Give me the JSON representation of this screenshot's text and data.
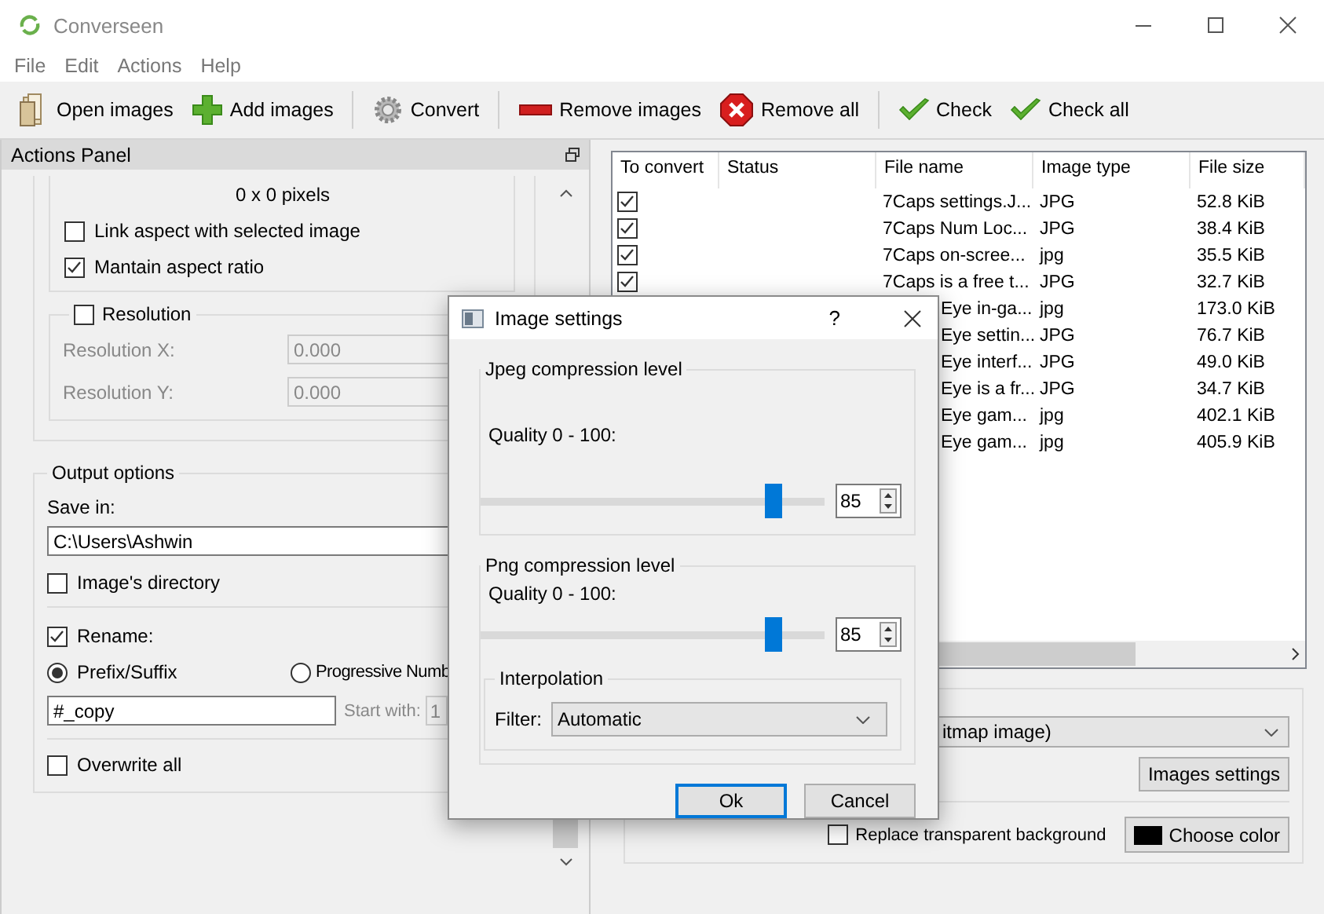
{
  "window": {
    "title": "Converseen"
  },
  "menu": [
    "File",
    "Edit",
    "Actions",
    "Help"
  ],
  "toolbar": [
    {
      "label": "Open images",
      "separator_before": false
    },
    {
      "label": "Add images",
      "separator_before": false
    },
    {
      "label": "Convert",
      "separator_before": true
    },
    {
      "label": "Remove images",
      "separator_before": true
    },
    {
      "label": "Remove all",
      "separator_before": false
    },
    {
      "label": "Check",
      "separator_before": true
    },
    {
      "label": "Check all",
      "separator_before": false
    }
  ],
  "actions_panel": {
    "title": "Actions Panel",
    "size_text": "0 x 0 pixels",
    "link_aspect": {
      "label": "Link aspect with selected image",
      "checked": false
    },
    "maintain_aspect": {
      "label": "Mantain aspect ratio",
      "checked": true
    },
    "resolution": {
      "label": "Resolution",
      "checked": false,
      "fields": [
        {
          "label": "Resolution X:",
          "value": "0.000",
          "disabled": true
        },
        {
          "label": "Resolution Y:",
          "value": "0.000",
          "disabled": true
        }
      ]
    },
    "output_options": {
      "title": "Output options",
      "save_in_label": "Save in:",
      "save_in": "C:\\Users\\Ashwin",
      "image_directory": {
        "label": "Image's directory",
        "checked": false
      },
      "rename": {
        "label": "Rename:",
        "checked": true
      },
      "rename_modes": [
        {
          "label": "Prefix/Suffix",
          "selected": true
        },
        {
          "label": "Progressive Numb",
          "selected": false
        }
      ],
      "pattern": "#_copy",
      "start_with": {
        "label": "Start with:",
        "value": "1",
        "disabled": true
      },
      "overwrite": {
        "label": "Overwrite all",
        "checked": false
      }
    }
  },
  "table": {
    "columns": [
      "To convert",
      "Status",
      "File name",
      "Image type",
      "File size"
    ],
    "rows": [
      {
        "kind": "full",
        "checked": true,
        "file_name": "7Caps settings.J...",
        "image_type": "JPG",
        "file_size": "52.8 KiB"
      },
      {
        "kind": "full",
        "checked": true,
        "file_name": "7Caps Num Loc...",
        "image_type": "JPG",
        "file_size": "38.4 KiB"
      },
      {
        "kind": "full",
        "checked": true,
        "file_name": "7Caps on-scree...",
        "image_type": "jpg",
        "file_size": "35.5 KiB"
      },
      {
        "kind": "full",
        "checked": true,
        "file_name": "7Caps is a free t...",
        "image_type": "JPG",
        "file_size": "32.7 KiB"
      },
      {
        "kind": "covered",
        "file_name": "Eye in-ga...",
        "image_type": "jpg",
        "file_size": "173.0 KiB"
      },
      {
        "kind": "covered",
        "file_name": "Eye settin...",
        "image_type": "JPG",
        "file_size": "76.7 KiB"
      },
      {
        "kind": "covered",
        "file_name": "Eye interf...",
        "image_type": "JPG",
        "file_size": "49.0 KiB"
      },
      {
        "kind": "covered",
        "file_name": "Eye is a fr...",
        "image_type": "JPG",
        "file_size": "34.7 KiB"
      },
      {
        "kind": "covered",
        "file_name": "Eye gam...",
        "image_type": "jpg",
        "file_size": "402.1 KiB"
      },
      {
        "kind": "covered",
        "file_name": "Eye gam...",
        "image_type": "jpg",
        "file_size": "405.9 KiB"
      }
    ]
  },
  "output_format": {
    "format": "itmap image)",
    "images_settings": "Images settings",
    "replace_background": {
      "label": "Replace transparent background",
      "checked": false
    },
    "choose_color": {
      "label": "Choose color",
      "color": "#000000"
    }
  },
  "dialog": {
    "title": "Image settings",
    "help": "?",
    "jpeg": {
      "title": "Jpeg compression level",
      "quality_label": "Quality 0 - 100:",
      "level": 0.85,
      "value": "85"
    },
    "png": {
      "title": "Png compression level",
      "quality_label": "Quality 0 - 100:",
      "level": 0.85,
      "value": "85"
    },
    "interpolation": {
      "title": "Interpolation",
      "filter_label": "Filter:",
      "filter": "Automatic"
    },
    "buttons": [
      {
        "label": "Ok",
        "default": true
      },
      {
        "label": "Cancel",
        "default": false
      }
    ]
  }
}
